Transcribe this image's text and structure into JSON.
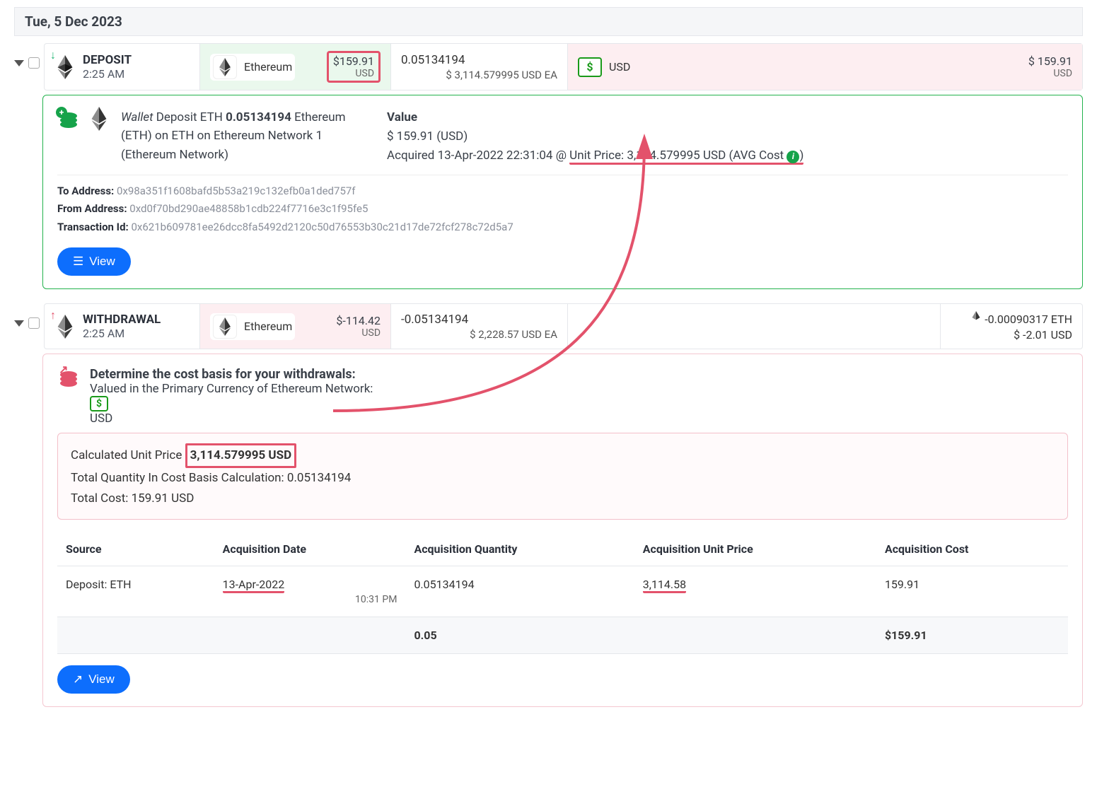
{
  "date_header": "Tue, 5 Dec 2023",
  "deposit": {
    "type": "DEPOSIT",
    "time": "2:25 AM",
    "coin_name": "Ethereum",
    "usd_value": "$159.91",
    "usd_unit": "USD",
    "qty": "0.05134194",
    "unit_price_line": "$ 3,114.579995 USD EA",
    "fiat_name": "USD",
    "fiat_value": "$ 159.91",
    "fiat_unit": "USD"
  },
  "deposit_detail": {
    "wallet_word": "Wallet",
    "desc1": " Deposit ETH ",
    "qty_bold": "0.05134194",
    "desc2": "Ethereum (ETH) on ETH on Ethereum Network 1 (Ethereum Network)",
    "value_label": "Value",
    "value_amount": "$ 159.91 (USD)",
    "acquired_prefix": "Acquired 13-Apr-2022 22:31:04 @ ",
    "unit_price_span": "Unit Price: 3,114.579995 USD (AVG Cost ",
    "close_paren": ")",
    "to_label": "To Address:",
    "to_val": "0x98a351f1608bafd5b53a219c132efb0a1ded757f",
    "from_label": "From Address:",
    "from_val": "0xd0f70bd290ae48858b1cdb224f7716e3c1f95fe5",
    "txid_label": "Transaction Id:",
    "txid_val": "0x621b609781ee26dcc8fa5492d2120c50d76553b30c21d17de72fcf278c72d5a7",
    "view_label": "View"
  },
  "withdrawal": {
    "type": "WITHDRAWAL",
    "time": "2:25 AM",
    "coin_name": "Ethereum",
    "usd_value": "$-114.42",
    "usd_unit": "USD",
    "qty": "-0.05134194",
    "unit_price_line": "$ 2,228.57 USD EA",
    "fee_qty": "-0.00090317 ETH",
    "fee_usd": "$ -2.01 USD"
  },
  "cost_panel": {
    "heading": "Determine the cost basis for your withdrawals:",
    "subline": "Valued in the Primary Currency of Ethereum Network: ",
    "sub_currency": "USD",
    "calc_label": "Calculated Unit Price ",
    "calc_value": "3,114.579995 USD",
    "total_qty_line": "Total Quantity In Cost Basis Calculation: 0.05134194",
    "total_cost_line": "Total Cost: 159.91 USD",
    "columns": {
      "source": "Source",
      "acq_date": "Acquisition Date",
      "acq_qty": "Acquisition Quantity",
      "acq_price": "Acquisition Unit Price",
      "acq_cost": "Acquisition Cost"
    },
    "row": {
      "source": "Deposit: ETH",
      "date": "13-Apr-2022",
      "date_time": "10:31 PM",
      "qty": "0.05134194",
      "price": "3,114.58",
      "cost": "159.91"
    },
    "totals": {
      "qty": "0.05",
      "cost": "$159.91"
    },
    "view_label": "View"
  }
}
